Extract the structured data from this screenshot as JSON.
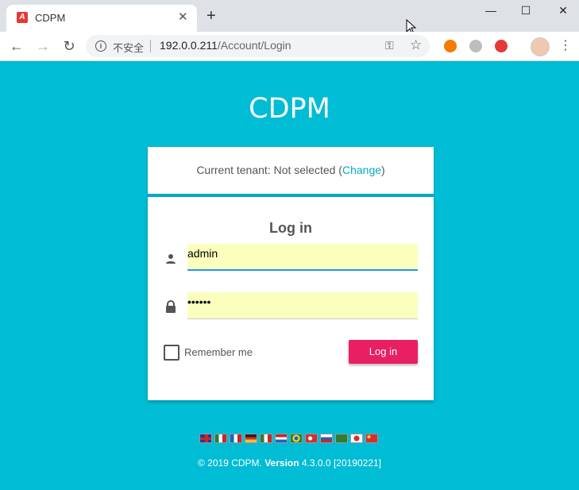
{
  "browser": {
    "tab_title": "CDPM",
    "favicon_letter": "A",
    "insecure_label": "不安全",
    "url_host": "192.0.0.211",
    "url_path": "/Account/Login"
  },
  "page": {
    "app_title": "CDPM",
    "tenant": {
      "prefix": "Current tenant: Not selected (",
      "change_link": "Change",
      "suffix": ")"
    },
    "login": {
      "heading": "Log in",
      "username_value": "admin",
      "password_value": "••••••",
      "remember_label": "Remember me",
      "submit_label": "Log in"
    },
    "languages": [
      "English",
      "Español (México)",
      "Français",
      "Deutsch",
      "Italiano",
      "Nederlands",
      "Português (Brasil)",
      "Türkçe",
      "Русский",
      "العربية",
      "日本語",
      "简体中文"
    ],
    "footer": {
      "copyright": "© 2019 CDPM.",
      "version_label": "Version",
      "version_value": "4.3.0.0 [20190221]"
    }
  },
  "colors": {
    "background": "#00bcd4",
    "accent": "#00acc1",
    "button": "#e91e63",
    "autofill": "#faffbd"
  }
}
